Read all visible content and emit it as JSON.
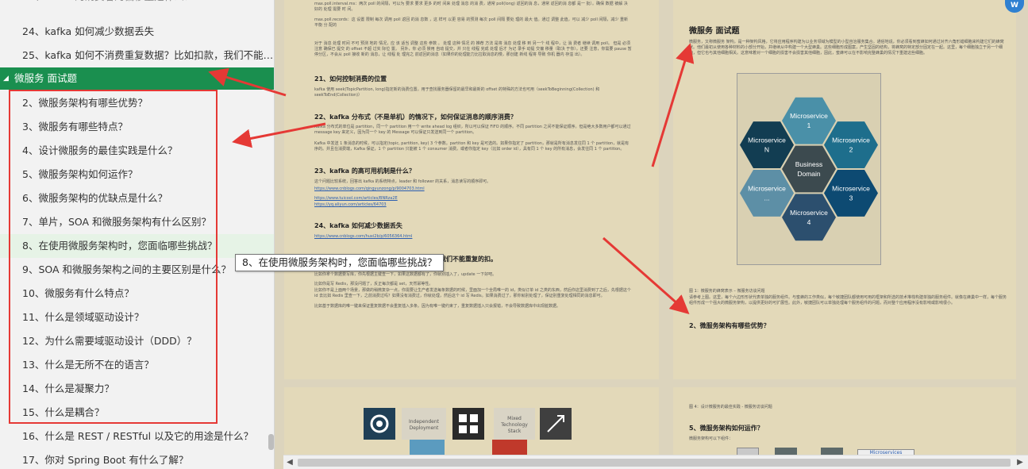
{
  "sidebar": {
    "partial_top": "23、kafka 的消费者的偏移量是什么？",
    "items_before": [
      "24、kafka 如何减少数据丢失",
      "25、kafka 如何不消费重复数据？比如扣款，我们不能重..."
    ],
    "section": "微服务 面试题",
    "items": [
      "2、微服务架构有哪些优势？",
      "3、微服务有哪些特点？",
      "4、设计微服务的最佳实践是什么？",
      "5、微服务架构如何运作？",
      "6、微服务架构的优缺点是什么？",
      "7、单片，SOA 和微服务架构有什么区别？",
      "8、在使用微服务架构时，您面临哪些挑战？",
      "9、SOA 和微服务架构之间的主要区别是什么？",
      "10、微服务有什么特点？",
      "11、什么是领域驱动设计？",
      "12、为什么需要域驱动设计（DDD）？",
      "13、什么是无所不在的语言？",
      "14、什么是凝聚力？",
      "15、什么是耦合？",
      "16、什么是 REST / RESTful 以及它的用途是什么？",
      "17、你对 Spring Boot 有什么了解？"
    ],
    "selected_index": 6
  },
  "tooltip": "8、在使用微服务架构时，您面临哪些挑战？",
  "doc": {
    "page1": {
      "intro1": "max.poll.interval.ms：两次 poll 的间隔，可以为 要求 要求 更多 的时 间来 处理 消息 的消 费，通常 poll(long) 返回的消 息，通常 返回的消 息都 是一 批）。确保 数据 被解 决 好的 处理 需要 时 间。",
      "intro2": "max.poll.records：这 设置 限制 每次 调用 poll 返回 的消 息数 ，这 样可 以更 容易 的预测 每次 poll 间隔 要处 理的 最大 值。通过 调整 此值，可以 减少 poll 间隔，减少 重新 平衡 分 配的",
      "intro3": "对于 消息 处理 时间 不可 预测 地的 情况，应 该 适当 调整 这些 参数 。 处理 这种 情况 的 推荐 方法 是将 消息 处理 移 到 另一个 线 程中，让 消 费者 继续 调用 poll。 但是 必须 注意 确保已 提交 的 offset 不超 过实 际位 置。 另外，你 必须 禁用 自动 提交，并 只在 线程 完成 处理 后才 为记 录手 动提 交偏 移量（取决 于你）。还要 注意，你需要 pause 暂停分区，不会从 poll 接收 新的 消息，让 线程 处 理完之 前返回的消息（如果你的处理能力比拉取消息的慢，那创建 新线 程将 导致 你机 器内 存溢 出）。",
      "h21": "21、如何控制消费的位置",
      "t21": "kafka 使用 seek(TopicPartition, long)指定新的消费位置。用于查找服务器保留的最早和最新的 offset 的特殊的方法也可用（seekToBeginning(Collection) 和 seekToEnd(Collection)）",
      "h22": "22、kafka 分布式（不是单机）的情况下，如何保证消息的顺序消费？",
      "t22a": "Kafka 分布式的单位是 partition，同一个 partition 用一个 write ahead log 组织，所以可以保证 FIFO 的顺序。不同 partition 之间不能保证顺序。但是绝大多数用户都可以通过 message key 来定义，因为同一个 key 的 Message 可以保证只发送到同一个 partition。",
      "t22b": "Kafka 中发送 1 条消息的时候，可以指定(topic, partition, key) 3 个参数。partiton 和 key 是可选的。如果你指定了 partition，那就是所有消息发往同 1 个 partition，就是有序的。并且在消费端，Kafka 保证，1 个 partition 只能被 1 个 consumer 消费。或者你指定 key（比如 order id），具有同 1 个 key 的所有消息，会发往同 1 个 partition。",
      "h23": "23、kafka 的高可用机制是什么？",
      "t23": "这个问题比较系统，回答出 kafka 的系统特点，leader 和 follower 的关系，消息读写的顺序即可。",
      "links23": [
        "https://www.cnblogs.com/qingyunzong/p/9004703.html",
        "https://www.tuicool.com/articles/BNRza2E",
        "https://yq.aliyun.com/articles/64703"
      ],
      "h24": "24、kafka 如何减少数据丢失",
      "link24": "https://www.cnblogs.com/huxi2b/p/6056364.html",
      "h25": "我们不能重复的扣。",
      "t25a": "比如你拿个数据要写库，你先根据主键查一下，如果这数据都有了，你就别插入了，update 一下好吧。",
      "t25b": "比如你是写 Redis，那没问题了，反正每次都是 set，天然幂等性。",
      "t25c": "比如你不是上面两个场景，那做的稍微复杂一点，你需要让生产者发送每条数据的时候，里面加一个全局唯一的 id，类似订单 id 之类的东西，然后你这里消费到了之后，先根据这个 id 去比如 Redis 里查一下，之前消费过吗？如果没有消费过，你就处理，然后这个 id 写 Redis。如果消费过了，那你就别处理了，保证别重复处理相同的消息即可。",
      "t25d": "比如基于数据库的唯一键来保证重复数据不会重复插入多条。因为有唯一键约束了，重复数据插入只会报错，不会导致数据库中出现脏数据。"
    },
    "page2": {
      "title": "微服务 面试题",
      "intro": "微服务，又称微服务 架构，是一种架构风格，它将应用程序构建为以业务领域为模型的小型自治服务集合。通俗地说，你必须看到蜜蜂如何通过对齐六角形蜡细胞来构建它们的蜂窝状。他们最初从使用各种材料的小部分开始，并继续从中构建一个大型蜂巢。这些细胞形成图案，产生坚固的结构，将蜂窝的特定部分固定在一起。这里，每个细胞独立于另一个细胞，但它也与其他细胞相关。这意味着对一个细胞的损害不会损害其他细胞，因此，蜜蜂可以在不影响完整蜂巢的情况下重建这些细胞。",
      "hex": {
        "center": [
          "Business",
          "Domain"
        ],
        "cells": [
          [
            "Microservice",
            "1"
          ],
          [
            "Microservice",
            "2"
          ],
          [
            "Microservice",
            "3"
          ],
          [
            "Microservice",
            "4"
          ],
          [
            "Microservice",
            "..."
          ],
          [
            "Microservice",
            "N"
          ]
        ]
      },
      "caption": "图 1：微服务的蜂窝表示 – 微服务访谈问题",
      "body": "请参考上图。这里，每个六边形形状代表单独的服务组件。与蜜蜂的工作类似，每个敏捷团队都使用可用的框架和所选的技术堆栈构建单独的服务组件。就像在蜂巢中一样，每个服务组件形成一个强大的微服务架构，以提供更好的可扩展性。此外，敏捷团队可以单独处理每个服务组件的问题，而对整个应用程序没有影响或影响很小。",
      "h2": "2、微服务架构有哪些优势？"
    },
    "page3": {
      "tiles": [
        "Independent Deployment",
        "Mixed Technology Stack"
      ]
    },
    "page4": {
      "caption": "图 4：设计微服务的最佳实践 - 微服务访谈问题",
      "h5": "5、微服务架构如何运作？",
      "t5": "微服务架构可以下组件：",
      "label": "Microservices"
    }
  },
  "corner_badge": "W",
  "colors": {
    "sidebar_section_bg": "#1a8f4f",
    "selected_bg": "#e6f3e6",
    "annotation_red": "#e53935",
    "hex_colors": [
      "#4a90a8",
      "#1e6e8c",
      "#0d4a72",
      "#2c4f6e",
      "#5d8fa6",
      "#123d52",
      "#3c4a4f"
    ]
  }
}
